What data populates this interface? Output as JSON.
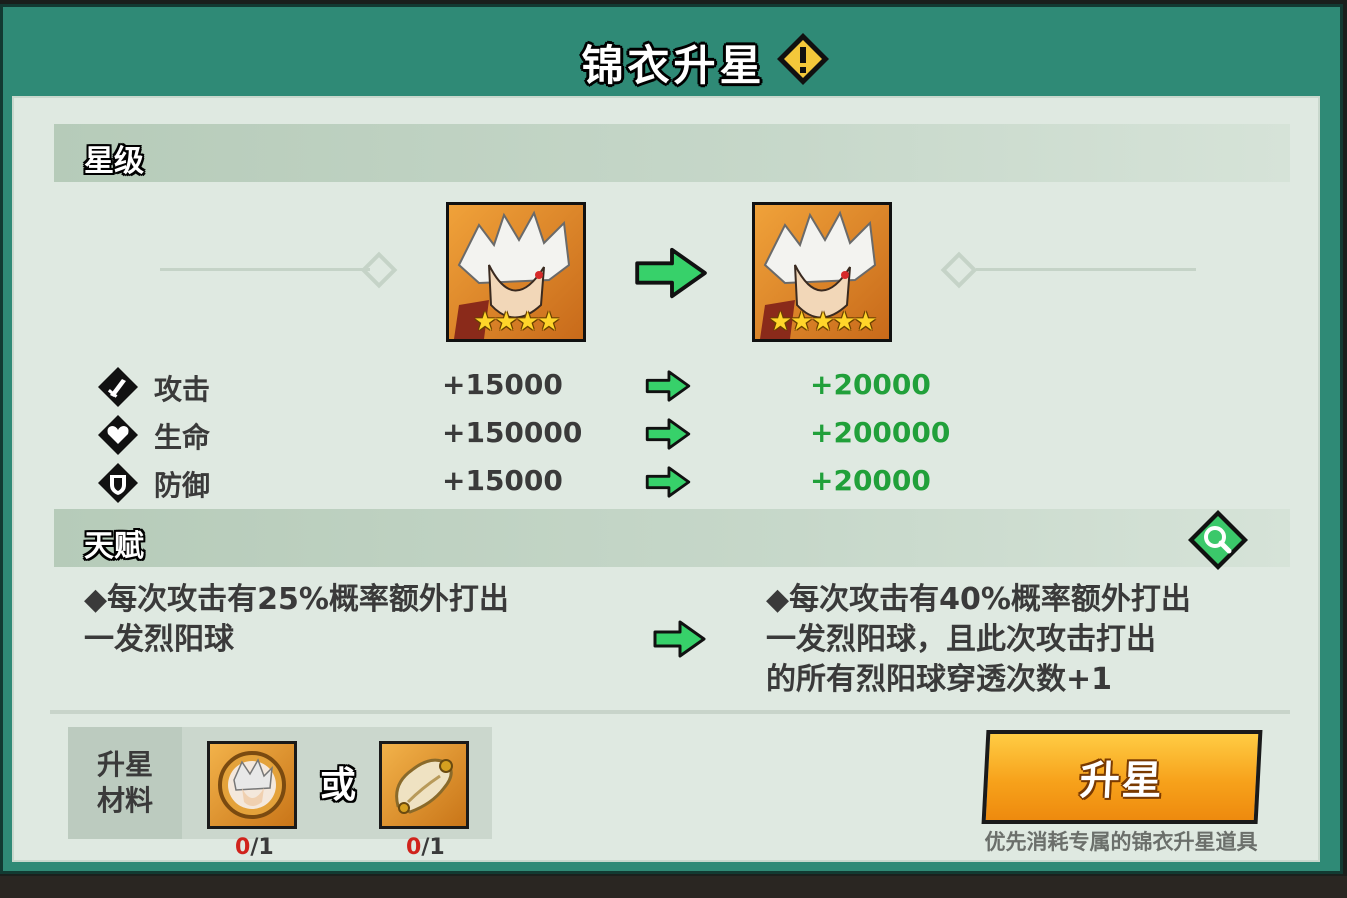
{
  "title": "锦衣升星",
  "icons": {
    "warning": "warning-icon",
    "attack": "sword-icon",
    "hp": "heart-icon",
    "defense": "shield-icon",
    "arrow": "green-arrow-icon",
    "search": "magnifier-icon"
  },
  "star_section": {
    "title": "星级",
    "before_stars": "★★★★",
    "after_stars": "★★★★★"
  },
  "stats": [
    {
      "name": "攻击",
      "before": "+15000",
      "after": "+20000"
    },
    {
      "name": "生命",
      "before": "+150000",
      "after": "+200000"
    },
    {
      "name": "防御",
      "before": "+15000",
      "after": "+20000"
    }
  ],
  "talent_section": {
    "title": "天赋",
    "before_lines": [
      "◆每次攻击有25%概率额外打出",
      "一发烈阳球"
    ],
    "after_lines": [
      "◆每次攻击有40%概率额外打出",
      "一发烈阳球，且此次攻击打出",
      "的所有烈阳球穿透次数+1"
    ]
  },
  "materials": {
    "label_line1": "升星",
    "label_line2": "材料",
    "or_text": "或",
    "items": [
      {
        "have": "0",
        "need": "/1"
      },
      {
        "have": "0",
        "need": "/1"
      }
    ]
  },
  "upgrade_button": "升星",
  "hint": "优先消耗专属的锦衣升星道具",
  "colors": {
    "frame": "#2f8a76",
    "panel": "#dfe9e1",
    "stat_green": "#21a03a",
    "button_orange": "#f7a21b",
    "count_red": "#d0231c"
  }
}
